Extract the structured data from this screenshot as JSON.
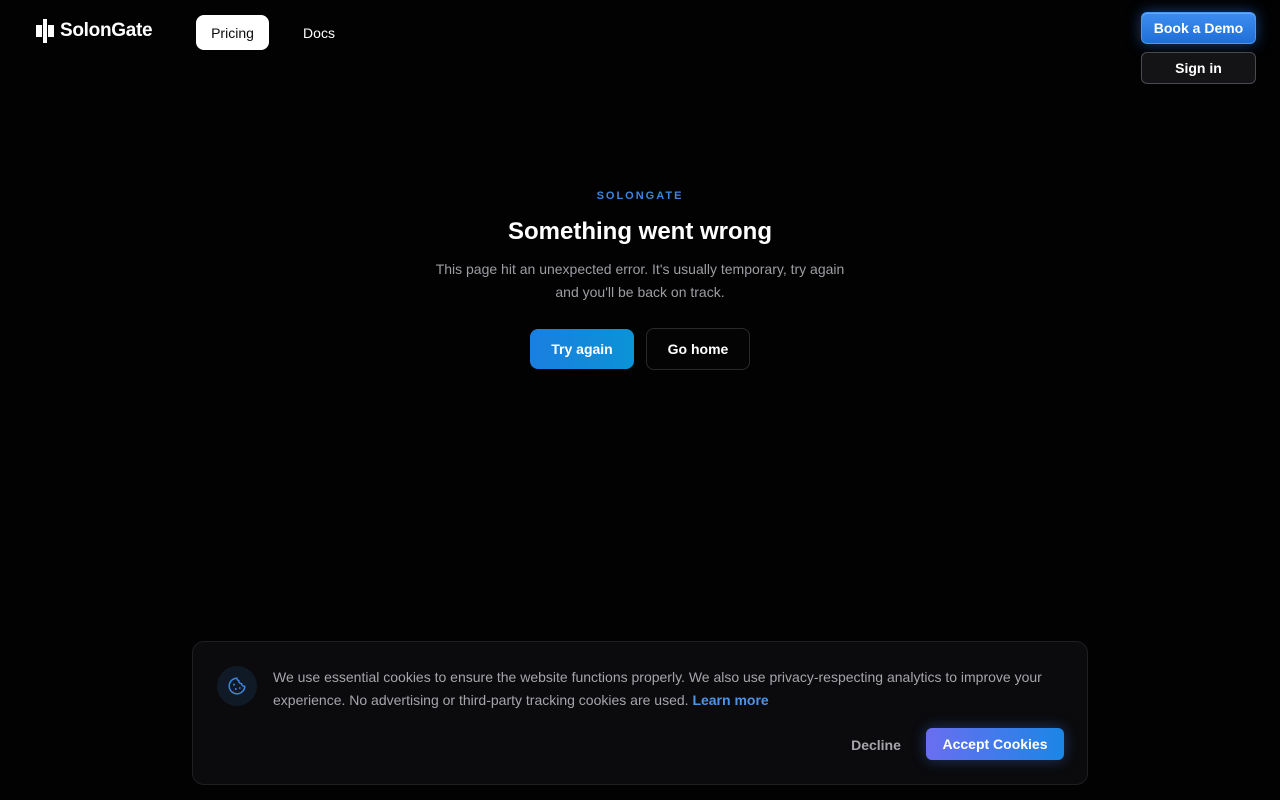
{
  "header": {
    "brand": "SolonGate",
    "nav": {
      "pricing_label": "Pricing",
      "docs_label": "Docs"
    },
    "book_demo_label": "Book a Demo",
    "sign_in_label": "Sign in"
  },
  "error": {
    "eyebrow": "SOLONGATE",
    "title": "Something went wrong",
    "description_line1": "This page hit an unexpected error. It's usually temporary, try again",
    "description_line2": "and you'll be back on track.",
    "try_again_label": "Try again",
    "go_home_label": "Go home"
  },
  "cookie_banner": {
    "icon": "cookie-icon",
    "text": "We use essential cookies to ensure the website functions properly. We also use privacy-respecting analytics to improve your experience. No advertising or third-party tracking cookies are used.",
    "learn_more_label": "Learn more",
    "decline_label": "Decline",
    "accept_label": "Accept Cookies"
  },
  "colors": {
    "background": "#020203",
    "accent_blue": "#3d86e0",
    "primary_button": "#1a7fe0",
    "link": "#4d93e8"
  }
}
